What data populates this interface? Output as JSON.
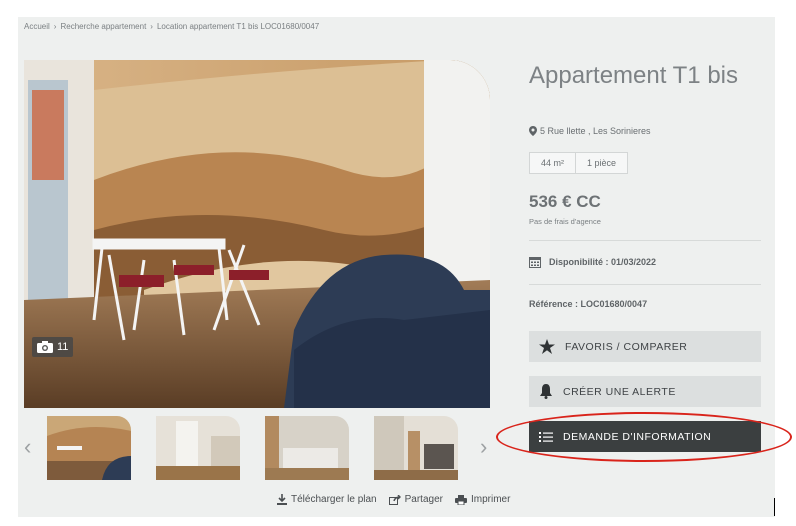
{
  "breadcrumb": [
    "Accueil",
    "Recherche appartement",
    "Location appartement T1 bis LOC01680/0047"
  ],
  "photo": {
    "count": "11"
  },
  "listing": {
    "title": "Appartement T1 bis",
    "address": "5 Rue llette , Les Sorinieres",
    "surface": "44 m²",
    "rooms": "1 pièce",
    "price": "536 € CC",
    "fees": "Pas de frais d'agence",
    "availability": "Disponibilité : 01/03/2022",
    "reference": "Référence : LOC01680/0047"
  },
  "buttons": {
    "favoris": "FAVORIS / COMPARER",
    "alerte": "CRÉER UNE ALERTE",
    "demande": "DEMANDE D'INFORMATION"
  },
  "bottom_actions": {
    "download": "Télécharger le plan",
    "share": "Partager",
    "print": "Imprimer"
  },
  "colors": {
    "panel_bg": "#eef0ef",
    "button_light": "#dcdfdf",
    "button_dark": "#3b3f40",
    "highlight": "#d9241b"
  },
  "icons": [
    "camera-icon",
    "chevron-left-icon",
    "chevron-right-icon",
    "map-pin-icon",
    "calendar-icon",
    "star-icon",
    "bell-icon",
    "list-icon",
    "download-icon",
    "share-icon",
    "print-icon"
  ]
}
